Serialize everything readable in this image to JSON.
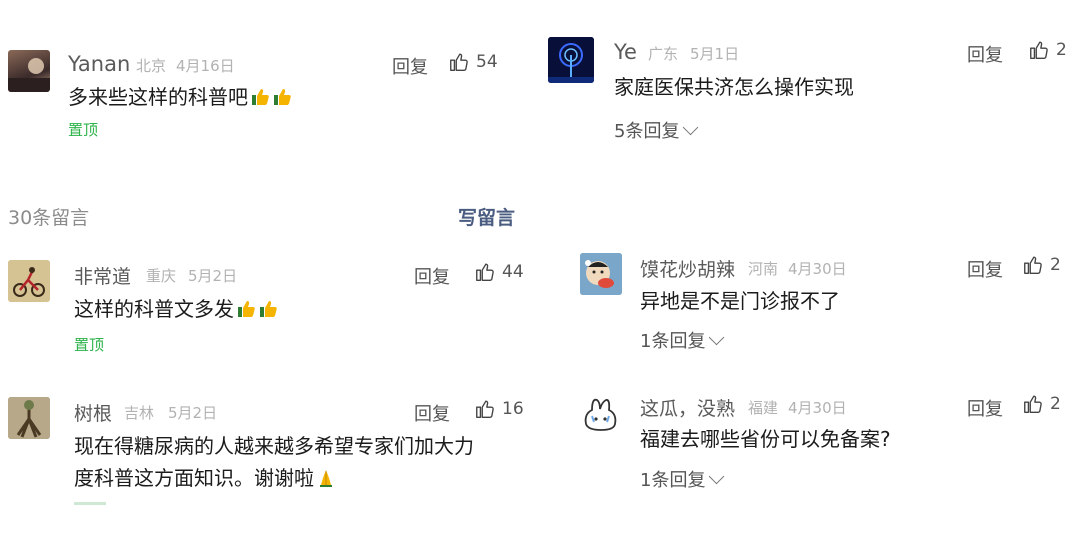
{
  "left": {
    "top_comment": {
      "name": "Yanan",
      "location": "北京",
      "date": "4月16日",
      "reply_label": "回复",
      "likes": "54",
      "text": "多来些这样的科普吧",
      "emoji": [
        "thumbs-up",
        "thumbs-up"
      ],
      "pinned_label": "置顶"
    },
    "section": {
      "count_label": "30条留言",
      "write_label": "写留言"
    },
    "comments": [
      {
        "name": "非常道",
        "location": "重庆",
        "date": "5月2日",
        "reply_label": "回复",
        "likes": "44",
        "text": "这样的科普文多发",
        "emoji": [
          "thumbs-up",
          "thumbs-up"
        ],
        "pinned_label": "置顶"
      },
      {
        "name": "树根",
        "location": "吉林",
        "date": "5月2日",
        "reply_label": "回复",
        "likes": "16",
        "text_line1": "现在得糖尿病的人越来越多希望专家们加大力",
        "text_line2": "度科普这方面知识。谢谢啦",
        "emoji": [
          "praying-hands"
        ]
      }
    ]
  },
  "right": {
    "comments": [
      {
        "name": "Ye",
        "location": "广东",
        "date": "5月1日",
        "reply_label": "回复",
        "likes": "2",
        "text": "家庭医保共济怎么操作实现",
        "replies_label": "5条回复"
      },
      {
        "name": "馍花炒胡辣",
        "location": "河南",
        "date": "4月30日",
        "reply_label": "回复",
        "likes": "2",
        "text": "异地是不是门诊报不了",
        "replies_label": "1条回复"
      },
      {
        "name": "这瓜，没熟",
        "location": "福建",
        "date": "4月30日",
        "reply_label": "回复",
        "likes": "2",
        "text": "福建去哪些省份可以免备案?",
        "replies_label": "1条回复"
      }
    ]
  },
  "colors": {
    "pinned": "#2db34a",
    "write_link": "#4a5d81",
    "meta": "#b2b2b2"
  },
  "icons": [
    "thumbs-up-icon",
    "chevron-down-icon",
    "praying-hands-emoji"
  ]
}
